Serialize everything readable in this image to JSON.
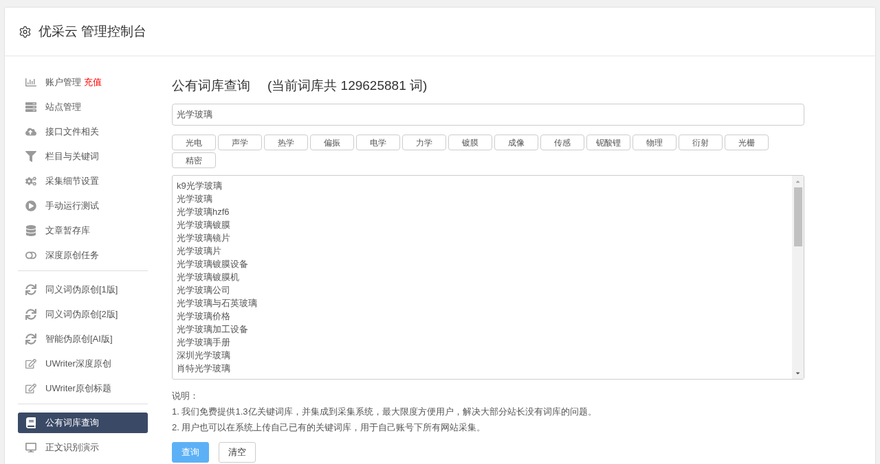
{
  "header": {
    "title": "优采云 管理控制台"
  },
  "sidebar": {
    "groups": [
      {
        "items": [
          {
            "label": "账户管理",
            "link": "充值",
            "selected": false
          },
          {
            "label": "站点管理",
            "selected": false
          },
          {
            "label": "接口文件相关",
            "selected": false
          },
          {
            "label": "栏目与关键词",
            "selected": false
          },
          {
            "label": "采集细节设置",
            "selected": false
          },
          {
            "label": "手动运行测试",
            "selected": false
          },
          {
            "label": "文章暂存库",
            "selected": false
          },
          {
            "label": "深度原创任务",
            "selected": false
          }
        ]
      },
      {
        "items": [
          {
            "label": "同义词伪原创[1版]",
            "selected": false
          },
          {
            "label": "同义词伪原创[2版]",
            "selected": false
          },
          {
            "label": "智能伪原创[AI版]",
            "selected": false
          },
          {
            "label": "UWriter深度原创",
            "selected": false
          },
          {
            "label": "UWriter原创标题",
            "selected": false
          }
        ]
      },
      {
        "items": [
          {
            "label": "公有词库查询",
            "selected": true
          },
          {
            "label": "正文识别演示",
            "selected": false
          }
        ]
      }
    ]
  },
  "main": {
    "title": "公有词库查询",
    "subtitle": "(当前词库共 129625881 词)",
    "search": {
      "value": "光学玻璃"
    },
    "tags": [
      "光电",
      "声学",
      "热学",
      "偏振",
      "电学",
      "力学",
      "镀膜",
      "成像",
      "传感",
      "铌酸锂",
      "物理",
      "衍射",
      "光栅",
      "精密"
    ],
    "results": [
      "k9光学玻璃",
      "光学玻璃",
      "光学玻璃hzf6",
      "光学玻璃镀膜",
      "光学玻璃镜片",
      "光学玻璃片",
      "光学玻璃镀膜设备",
      "光学玻璃镀膜机",
      "光学玻璃公司",
      "光学玻璃与石英玻璃",
      "光学玻璃价格",
      "光学玻璃加工设备",
      "光学玻璃手册",
      "深圳光学玻璃",
      "肖特光学玻璃"
    ],
    "notes": {
      "heading": "说明：",
      "lines": [
        "1. 我们免费提供1.3亿关键词库，并集成到采集系统，最大限度方便用户，解决大部分站长没有词库的问题。",
        "2. 用户也可以在系统上传自己已有的关键词库，用于自己账号下所有网站采集。"
      ]
    },
    "buttons": [
      {
        "label": "查询",
        "kind": "primary"
      },
      {
        "label": "清空",
        "kind": "default"
      }
    ]
  }
}
